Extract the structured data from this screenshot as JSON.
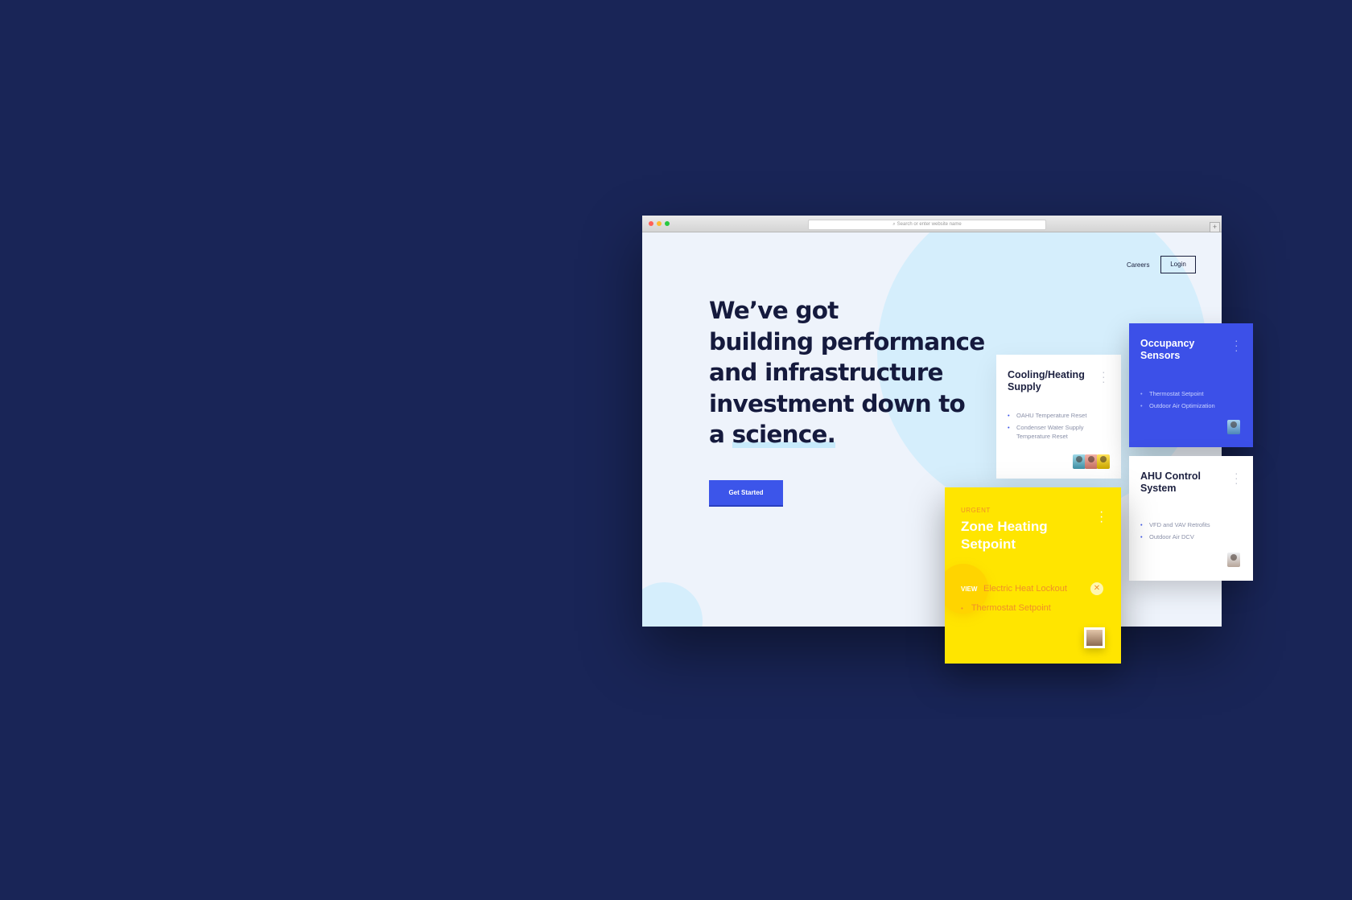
{
  "browser": {
    "address_placeholder": "Search or enter website name",
    "search_icon": "search-icon",
    "new_tab_glyph": "+"
  },
  "nav": {
    "careers": "Careers",
    "login": "Login"
  },
  "hero": {
    "line1": "We’ve got",
    "line2": "building performance",
    "line3": "and infrastructure",
    "line4": "investment down to",
    "line5_prefix": "a ",
    "line5_highlight": "science.",
    "cta": "Get Started"
  },
  "cards": {
    "cooling": {
      "title": "Cooling/Heating Supply",
      "items": [
        "OAHU Temperature Reset",
        "Condenser Water Supply Temperature Reset"
      ]
    },
    "occupancy": {
      "title": "Occupancy Sensors",
      "items": [
        "Thermostat Setpoint",
        "Outdoor Air Optimization"
      ]
    },
    "ahu": {
      "title": "AHU Control System",
      "items": [
        "VFD and VAV Retrofits",
        "Outdoor Air DCV"
      ]
    },
    "zone": {
      "tag": "URGENT",
      "title": "Zone Heating Setpoint",
      "view": "VIEW",
      "item1": "Electric Heat Lockout",
      "close_glyph": "✕",
      "item2": "Thermostat Setpoint"
    }
  },
  "colors": {
    "background": "#192557",
    "accent_blue": "#3c55ea",
    "urgent_yellow": "#ffe500",
    "urgent_orange": "#f08f2a"
  }
}
